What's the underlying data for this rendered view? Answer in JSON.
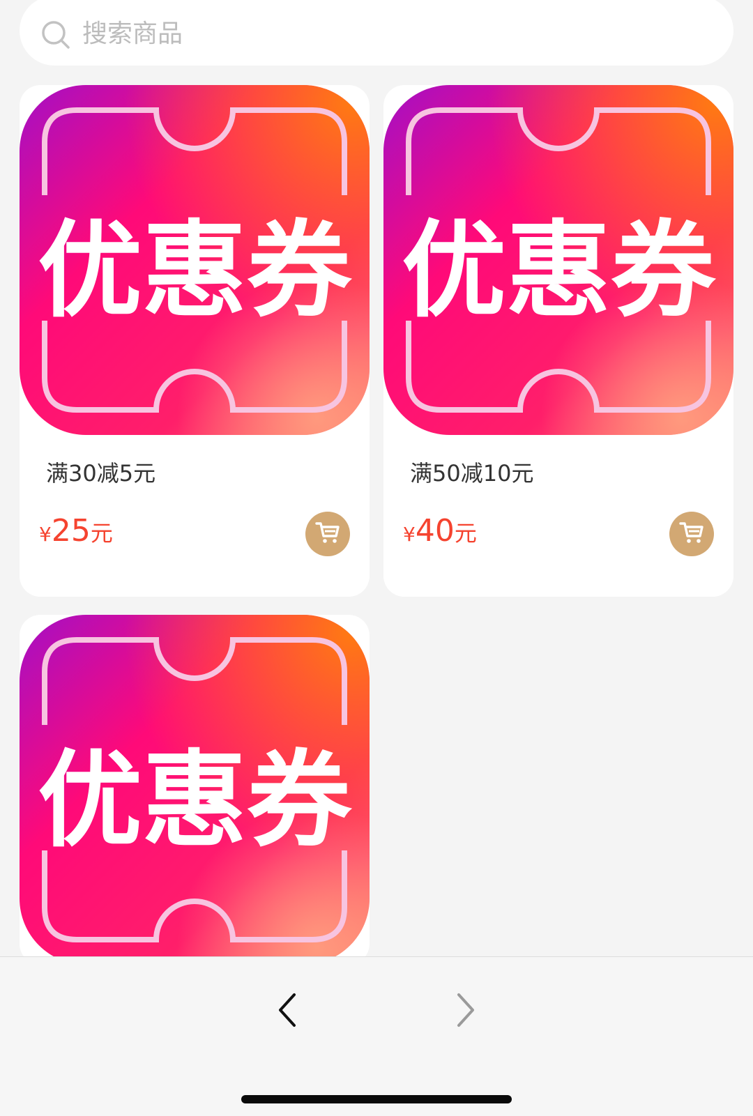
{
  "search": {
    "placeholder": "搜索商品"
  },
  "products": [
    {
      "image_text": "优惠券",
      "title": "满30减5元",
      "price_symbol": "¥",
      "price_value": "25",
      "price_unit": "元"
    },
    {
      "image_text": "优惠券",
      "title": "满50减10元",
      "price_symbol": "¥",
      "price_value": "40",
      "price_unit": "元"
    },
    {
      "image_text": "优惠券"
    }
  ],
  "icons": {
    "search": "search-icon",
    "cart": "shopping-cart-icon",
    "back": "chevron-left-icon",
    "forward": "chevron-right-icon"
  },
  "colors": {
    "background": "#f4f4f4",
    "price": "#f5432f",
    "cart_button": "#d2a873",
    "gradient_purple": "#a40fc4",
    "gradient_pink": "#ff0a78",
    "gradient_orange": "#ff6a1a"
  }
}
